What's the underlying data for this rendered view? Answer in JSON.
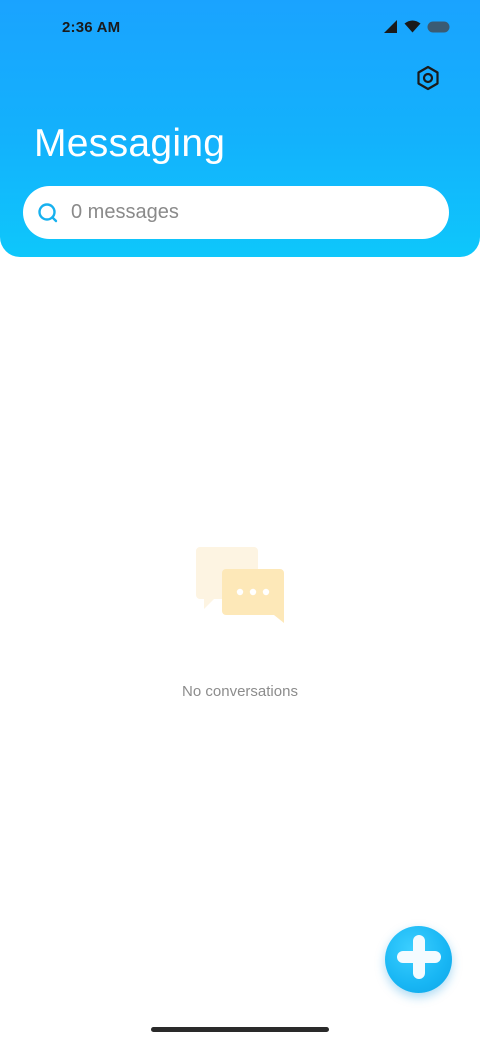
{
  "status_bar": {
    "time": "2:36 AM"
  },
  "header": {
    "title": "Messaging",
    "settings_icon": "gear-icon"
  },
  "search": {
    "placeholder": "0 messages",
    "icon": "search-icon"
  },
  "empty_state": {
    "message": "No conversations",
    "icon": "chat-bubbles-icon"
  },
  "fab": {
    "icon": "plus-icon"
  },
  "colors": {
    "header_gradient_top": "#1aa3ff",
    "header_gradient_bottom": "#0ec7fb",
    "accent": "#18b6f4",
    "empty_illustration": "#fde8b8"
  }
}
